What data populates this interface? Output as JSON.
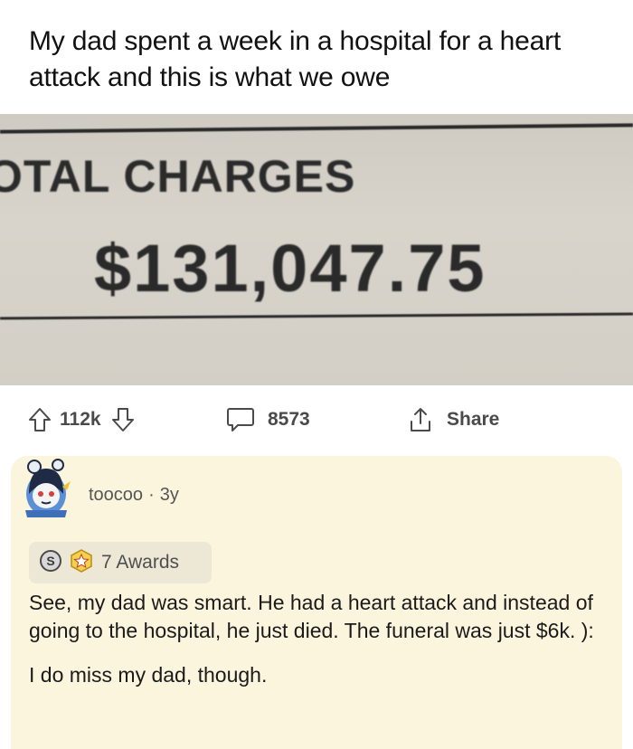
{
  "post": {
    "title": "My dad spent a week in a hospital for a heart attack and this is what we owe",
    "image": {
      "label_text": "OTAL CHARGES",
      "amount_text": "$131,047.75"
    },
    "actions": {
      "upvotes": "112k",
      "comments": "8573",
      "share_label": "Share"
    }
  },
  "comment": {
    "username": "toocoo",
    "separator": "·",
    "age": "3y",
    "awards_label": "7 Awards",
    "silver_award_letter": "S",
    "body": [
      "See, my dad was smart. He had a heart attack and instead of going to the hospital, he just died. The funeral was just $6k. ):",
      "I do miss my dad, though."
    ]
  },
  "icons": {
    "upvote": "upvote-arrow-icon",
    "downvote": "downvote-arrow-icon",
    "comment": "comment-bubble-icon",
    "share": "share-upload-icon",
    "silver_award": "silver-award-icon",
    "gold_award": "gold-star-award-icon"
  },
  "colors": {
    "comment_background": "#fcf5de",
    "awards_background": "#ede7d5",
    "action_text": "#4a4a4a"
  }
}
